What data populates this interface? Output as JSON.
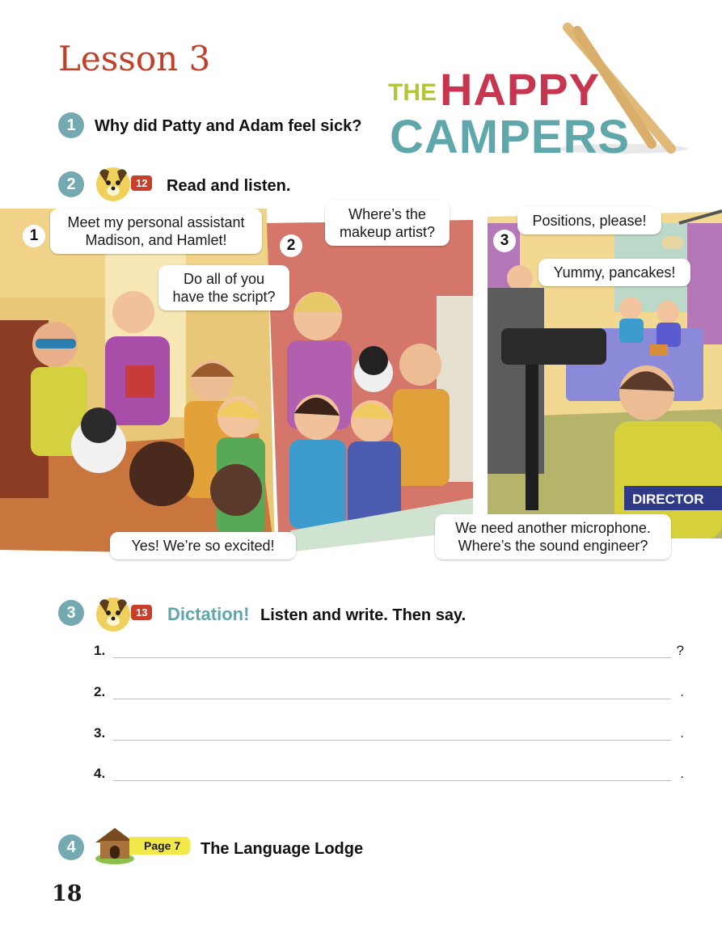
{
  "lesson": {
    "title": "Lesson 3"
  },
  "logo": {
    "line1": "THE",
    "line2": "HAPPY",
    "line3": "CAMPERS"
  },
  "activities": [
    {
      "number": "1",
      "text": "Why did Patty and Adam feel sick?"
    },
    {
      "number": "2",
      "track": "12",
      "text": "Read and listen."
    },
    {
      "number": "3",
      "track": "13",
      "highlight": "Dictation!",
      "text": "Listen and write. Then say."
    },
    {
      "number": "4",
      "page_tag": "Page 7",
      "text": "The Language Lodge"
    }
  ],
  "comic": {
    "panels": [
      {
        "number": "1",
        "bubbles": [
          "Meet my personal assistant\nMadison, and Hamlet!",
          "Do all of you\nhave the script?",
          "Yes! We’re so excited!"
        ]
      },
      {
        "number": "2",
        "bubbles": [
          "Where’s the\nmakeup artist?"
        ]
      },
      {
        "number": "3",
        "sign": "DIRECTOR",
        "bubbles": [
          "Positions, please!",
          "Yummy, pancakes!",
          "We need another microphone.\nWhere’s the sound engineer?"
        ]
      }
    ]
  },
  "dictation_lines": [
    {
      "number": "1.",
      "end": "?"
    },
    {
      "number": "2.",
      "end": "."
    },
    {
      "number": "3.",
      "end": "."
    },
    {
      "number": "4.",
      "end": "."
    }
  ],
  "page_number": "18",
  "colors": {
    "title": "#c0402a",
    "teal": "#74a9b1",
    "track": "#c8402b",
    "page_tag": "#f2e84a"
  }
}
